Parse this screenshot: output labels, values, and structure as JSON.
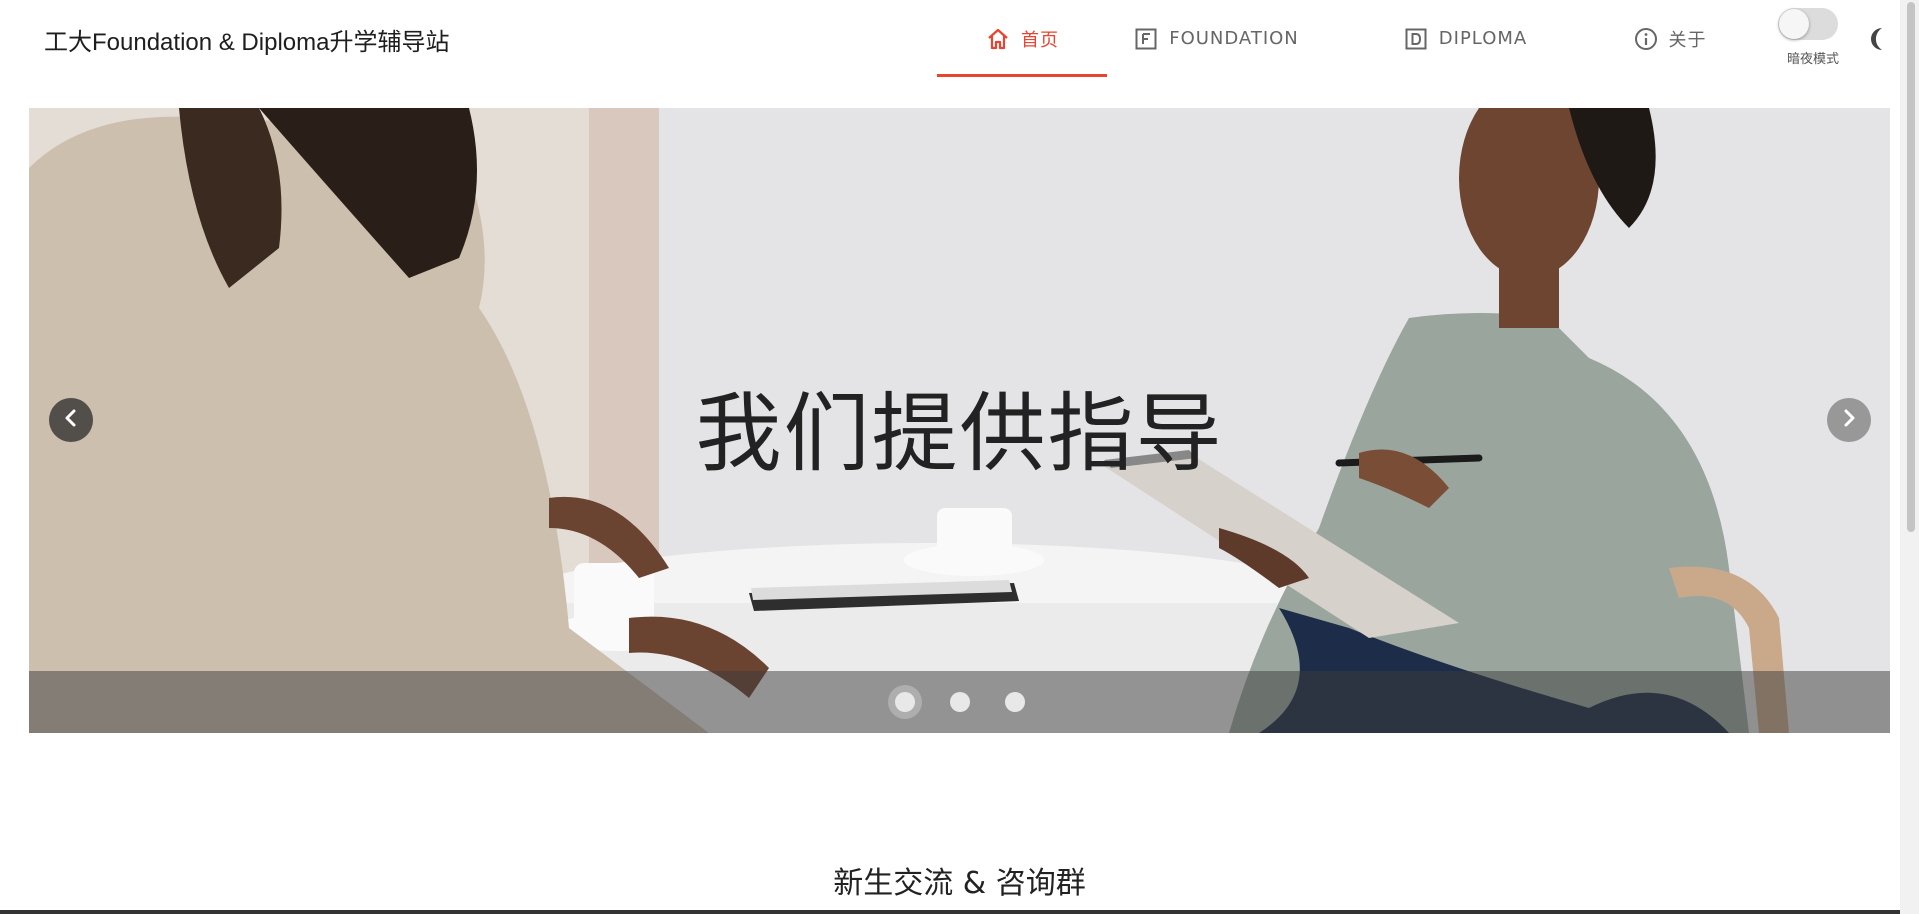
{
  "header": {
    "site_title": "工大Foundation & Diploma升学辅导站",
    "nav": [
      {
        "label": "首页",
        "icon": "home-icon",
        "active": true
      },
      {
        "label": "FOUNDATION",
        "icon": "letter-f-box-icon",
        "active": false
      },
      {
        "label": "DIPLOMA",
        "icon": "letter-d-box-icon",
        "active": false
      },
      {
        "label": "关于",
        "icon": "info-circle-icon",
        "active": false
      }
    ],
    "dark_mode": {
      "label": "暗夜模式",
      "enabled": false,
      "icon": "moon-icon"
    }
  },
  "carousel": {
    "caption": "我们提供指导",
    "slide_count": 3,
    "active_index": 0,
    "prev_icon": "chevron-left-icon",
    "next_icon": "chevron-right-icon"
  },
  "section": {
    "title": "新生交流 & 咨询群"
  },
  "colors": {
    "accent": "#e8442f",
    "text": "#222222",
    "muted": "#666666"
  }
}
